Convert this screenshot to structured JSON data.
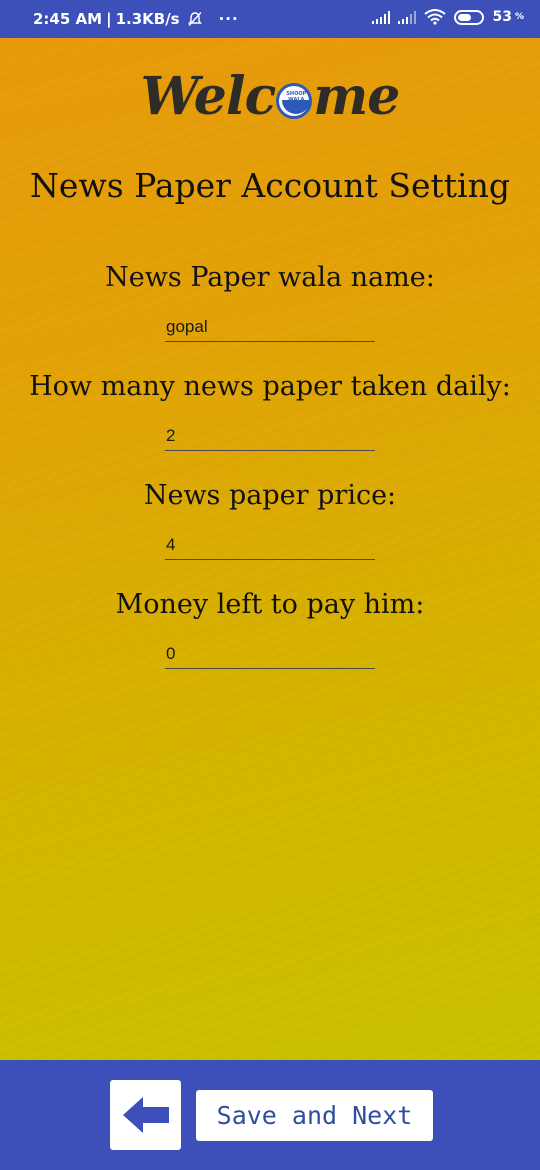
{
  "status_bar": {
    "time": "2:45 AM",
    "separator": "|",
    "net_speed": "1.3KB/s",
    "bell_icon": "bell-off-icon",
    "more": "···",
    "battery_level": "53",
    "battery_unit": "%"
  },
  "header": {
    "logo_pre": "Welc",
    "logo_o_text": "SHOOP WALA",
    "logo_post": "me",
    "title": "News Paper Account Setting"
  },
  "form": {
    "fields": [
      {
        "label": "News Paper wala name:",
        "value": "gopal"
      },
      {
        "label": "How many news paper taken daily:",
        "value": "2"
      },
      {
        "label": "News paper price:",
        "value": "4"
      },
      {
        "label": "Money left to pay him:",
        "value": "0"
      }
    ]
  },
  "footer": {
    "back_icon": "arrow-left-icon",
    "save_label": "Save and Next"
  },
  "colors": {
    "bar": "#3d4fb8",
    "gradient_top": "#e89a0b",
    "gradient_bottom": "#c9c200",
    "button_text": "#2f4ea0"
  }
}
